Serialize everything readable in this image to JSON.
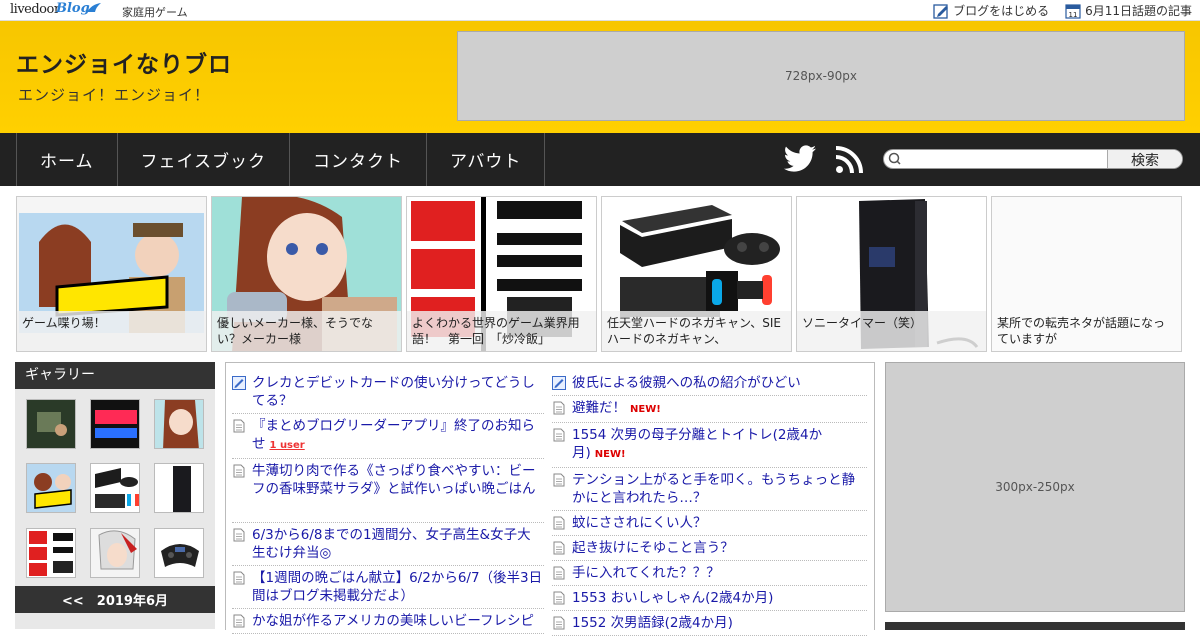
{
  "topbar": {
    "logo_text": "livedoor",
    "logo_blog": "Blog",
    "category": "家庭用ゲーム",
    "start_blog": "ブログをはじめる",
    "calendar_day": "11",
    "topics": "6月11日話題の記事"
  },
  "header": {
    "title": "エンジョイなりブロ",
    "subtitle": "エンジョイ！エンジョイ！",
    "ad_label": "728px-90px"
  },
  "nav": {
    "items": [
      "ホーム",
      "フェイスブック",
      "コンタクト",
      "アバウト"
    ],
    "search_placeholder": "",
    "search_button": "検索"
  },
  "featured": [
    {
      "caption": "ゲーム喋り場！"
    },
    {
      "caption": "優しいメーカー様、そうでない？メーカー様"
    },
    {
      "caption": "よくわかる世界のゲーム業界用語！　第一回　「炒冷飯」"
    },
    {
      "caption": "任天堂ハードのネガキャン、SIEハードのネガキャン、"
    },
    {
      "caption": "ソニータイマー（笑）"
    },
    {
      "caption": "某所での転売ネタが話題になっていますが"
    }
  ],
  "sidebar": {
    "gallery_title": "ギャラリー",
    "calendar_title": "<<　2019年6月"
  },
  "entries_left": [
    {
      "title": "クレカとデビットカードの使い分けってどうしてる？",
      "icon": "edit-icon"
    },
    {
      "title": "『まとめブログリーダーアプリ』終了のお知らせ",
      "icon": "doc-icon",
      "badge": "1 user"
    },
    {
      "title": "牛薄切り肉で作る《さっぱり食べやすい：ビーフの香味野菜サラダ》と試作いっぱい晩ごはん",
      "icon": "doc-icon"
    },
    {
      "title": "6/3から6/8までの1週間分、女子高生&女子大生むけ弁当◎",
      "icon": "doc-icon"
    },
    {
      "title": "【1週間の晩ごはん献立】6/2から6/7（後半3日間はブログ未掲載分だよ）",
      "icon": "doc-icon"
    },
    {
      "title": "かな姐が作るアメリカの美味しいビーフレシピ",
      "icon": "doc-icon"
    }
  ],
  "entries_right": [
    {
      "title": "彼氏による彼親への私の紹介がひどい",
      "icon": "edit-icon"
    },
    {
      "title": "避難だ！",
      "icon": "doc-icon",
      "new": "NEW!"
    },
    {
      "title": "1554 次男の母子分離とトイトレ(2歳4か月)",
      "icon": "doc-icon",
      "new": "NEW!"
    },
    {
      "title": "テンション上がると手を叩く。もうちょっと静かにと言われたら…？",
      "icon": "doc-icon"
    },
    {
      "title": "蚊にさされにくい人？",
      "icon": "doc-icon"
    },
    {
      "title": "起き抜けにそゆこと言う？",
      "icon": "doc-icon"
    },
    {
      "title": "手に入れてくれた？？？",
      "icon": "doc-icon"
    },
    {
      "title": "1553 おいしゃしゃん(2歳4か月)",
      "icon": "doc-icon"
    },
    {
      "title": "1552 次男語録(2歳4か月)",
      "icon": "doc-icon"
    }
  ],
  "right": {
    "ad_label": "300px-250px"
  },
  "colors": {
    "header_yellow": "#ffcc00",
    "nav_dark": "#222222",
    "link_blue": "#1a1aa8",
    "new_red": "#dd0000"
  }
}
